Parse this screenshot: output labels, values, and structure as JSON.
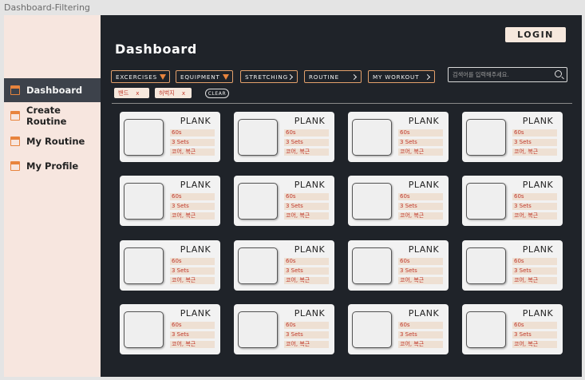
{
  "frame_title": "Dashboard-Filtering",
  "header": {
    "title": "Dashboard",
    "login_label": "LOGIN"
  },
  "sidebar": {
    "items": [
      {
        "label": "Dashboard",
        "active": true
      },
      {
        "label": "Create Routine",
        "active": false
      },
      {
        "label": "My Routine",
        "active": false
      },
      {
        "label": "My Profile",
        "active": false
      }
    ]
  },
  "filters": [
    {
      "label": "EXCERCISES",
      "indicator": "dropdown"
    },
    {
      "label": "EQUIPMENT",
      "indicator": "dropdown"
    },
    {
      "label": "STRETCHING",
      "indicator": "chevron"
    },
    {
      "label": "ROUTINE",
      "indicator": "chevron"
    },
    {
      "label": "MY WORKOUT",
      "indicator": "chevron"
    }
  ],
  "search": {
    "placeholder": "검색어를 입력해주세요."
  },
  "active_filters": [
    {
      "label": "밴드",
      "remove": "x"
    },
    {
      "label": "허벅지",
      "remove": "x"
    }
  ],
  "clear_label": "CLEAR",
  "cards": [
    {
      "title": "PLANK",
      "duration": "60s",
      "sets": "3 Sets",
      "muscles": "코어, 복근"
    },
    {
      "title": "PLANK",
      "duration": "60s",
      "sets": "3 Sets",
      "muscles": "코어, 복근"
    },
    {
      "title": "PLANK",
      "duration": "60s",
      "sets": "3 Sets",
      "muscles": "코어, 복근"
    },
    {
      "title": "PLANK",
      "duration": "60s",
      "sets": "3 Sets",
      "muscles": "코어, 복근"
    },
    {
      "title": "PLANK",
      "duration": "60s",
      "sets": "3 Sets",
      "muscles": "코어, 복근"
    },
    {
      "title": "PLANK",
      "duration": "60s",
      "sets": "3 Sets",
      "muscles": "코어, 복근"
    },
    {
      "title": "PLANK",
      "duration": "60s",
      "sets": "3 Sets",
      "muscles": "코어, 복근"
    },
    {
      "title": "PLANK",
      "duration": "60s",
      "sets": "3 Sets",
      "muscles": "코어, 복근"
    },
    {
      "title": "PLANK",
      "duration": "60s",
      "sets": "3 Sets",
      "muscles": "코어, 복근"
    },
    {
      "title": "PLANK",
      "duration": "60s",
      "sets": "3 Sets",
      "muscles": "코어, 복근"
    },
    {
      "title": "PLANK",
      "duration": "60s",
      "sets": "3 Sets",
      "muscles": "코어, 복근"
    },
    {
      "title": "PLANK",
      "duration": "60s",
      "sets": "3 Sets",
      "muscles": "코어, 복근"
    },
    {
      "title": "PLANK",
      "duration": "60s",
      "sets": "3 Sets",
      "muscles": "코어, 복근"
    },
    {
      "title": "PLANK",
      "duration": "60s",
      "sets": "3 Sets",
      "muscles": "코어, 복근"
    },
    {
      "title": "PLANK",
      "duration": "60s",
      "sets": "3 Sets",
      "muscles": "코어, 복근"
    },
    {
      "title": "PLANK",
      "duration": "60s",
      "sets": "3 Sets",
      "muscles": "코어, 복근"
    }
  ],
  "colors": {
    "accent": "#e8843d",
    "background": "#1f2329",
    "sidebar": "#f7e6df",
    "tag_text": "#c0392b"
  }
}
